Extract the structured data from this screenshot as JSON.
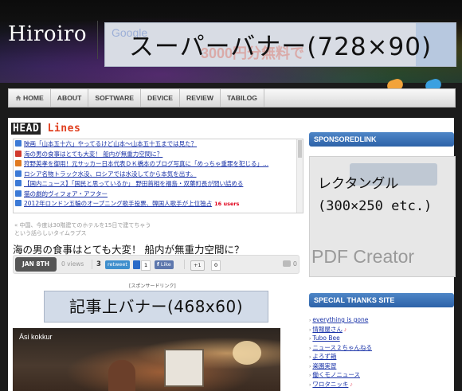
{
  "header": {
    "logo": "Hiroiro",
    "super_banner_label": "スーパーバナー(728×90)",
    "banner_faint_brand": "Google",
    "banner_faint_promo": "3000円分無料で"
  },
  "nav": {
    "items": [
      {
        "label": "HOME",
        "icon": "home-icon"
      },
      {
        "label": "ABOUT"
      },
      {
        "label": "SOFTWARE"
      },
      {
        "label": "DEVICE"
      },
      {
        "label": "REVIEW"
      },
      {
        "label": "TABILOG"
      }
    ]
  },
  "headlines": {
    "title_a": "HEAD",
    "title_b": " Lines",
    "items": [
      {
        "text": "映画「山本五十六」やってるけど山本〜山本五十五までは見た？",
        "icon_color": "#3c7ad6"
      },
      {
        "text": "海の男の食事はとても大変！ 船内が無重力空間に？",
        "icon_color": "#d13a2e"
      },
      {
        "text": "狩野英孝を御用！元サッカー日本代表ＤＫ橋本のブログ写真に「めっちゃ重罪を犯じる」...",
        "icon_color": "#e07a20"
      },
      {
        "text": "ロシア名物トラック水没、ロシアでは水没してから本気を出す。",
        "icon_color": "#3c7ad6"
      },
      {
        "text": "【国内ニュース】「国民と思っているか」 野田首相を福島・双葉町長が問い詰める",
        "icon_color": "#3c7ad6"
      },
      {
        "text": "猫の劇的ヴィフォア・アフター",
        "icon_color": "#3c7ad6"
      },
      {
        "text": "2012年ロンドン五輪のオープニング歌手投票、韓国人歌手が上位独占",
        "icon_color": "#3c7ad6",
        "users": "16 users"
      }
    ]
  },
  "faded_text": {
    "line1": "« 中国、今度は30階建てのホテルを15日で建てちゃう",
    "line2": "という話らしいタイムラプス"
  },
  "post": {
    "title": "海の男の食事はとても大変！ 船内が無重力空間に？",
    "date": "JAN 8TH",
    "views": "0 views",
    "retweet_count": "3",
    "retweet_label": "retweet",
    "bookmark_count": "1",
    "like_label": "Like",
    "plusone_label": "+1",
    "plusone_count": "0",
    "comment_count": "0"
  },
  "article_ad": {
    "sponsored_label": "[スポンサードリンク]",
    "banner_label": "記事上バナー(468x60)"
  },
  "photo": {
    "caption": "Ási kokkur"
  },
  "sidebar": {
    "sponsored_head": "SPONSOREDLINK",
    "rect_ad_label_line1": "レクタングル",
    "rect_ad_label_line2": "(300×250 etc.)",
    "rect_ad_faint_brand": "PDF Creator",
    "thanks_head": "SPECIAL THANKS SITE",
    "thanks": [
      {
        "label": "everything is gone"
      },
      {
        "label": "情報屋さん",
        "badge": "♪"
      },
      {
        "label": "Tubo Bee"
      },
      {
        "label": "ニュース２ちゃんねる"
      },
      {
        "label": "よろず箱"
      },
      {
        "label": "楽園実習"
      },
      {
        "label": "働くモノニュース"
      },
      {
        "label": "ワロタニッキ",
        "badge": "♪"
      }
    ]
  },
  "colors": {
    "accent_blue": "#2d62a8",
    "link": "#1a33a8",
    "users_red": "#e0001a"
  }
}
